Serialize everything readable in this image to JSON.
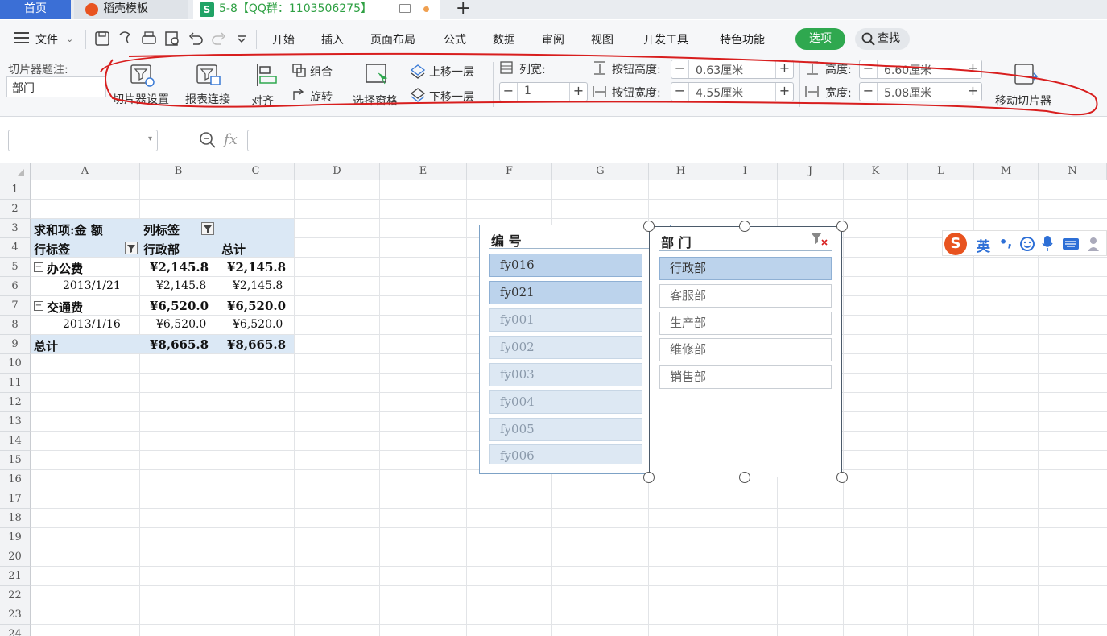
{
  "tabs": {
    "home": "首页",
    "daoke": "稻壳模板",
    "file": "5-8【QQ群：1103506275】",
    "file_icon": "S"
  },
  "menu": {
    "file": "文件",
    "items": [
      "开始",
      "插入",
      "页面布局",
      "公式",
      "数据",
      "审阅",
      "视图",
      "开发工具",
      "特色功能"
    ],
    "options": "选项",
    "search": "查找"
  },
  "ribbon": {
    "caption_label": "切片器题注:",
    "caption_value": "部门",
    "slicer_settings": "切片器设置",
    "report_connect": "报表连接",
    "align": "对齐",
    "group": "组合",
    "rotate": "旋转",
    "selection_pane": "选择窗格",
    "bring_forward": "上移一层",
    "send_backward": "下移一层",
    "columns_label": "列宽:",
    "columns_value": "1",
    "btn_height_label": "按钮高度:",
    "btn_height_value": "0.63厘米",
    "btn_width_label": "按钮宽度:",
    "btn_width_value": "4.55厘米",
    "height_label": "高度:",
    "height_value": "6.60厘米",
    "width_label": "宽度:",
    "width_value": "5.08厘米",
    "move_slicer": "移动切片器"
  },
  "formula": {
    "fx": "fx"
  },
  "columns": [
    "A",
    "B",
    "C",
    "D",
    "E",
    "F",
    "G",
    "H",
    "I",
    "J",
    "K",
    "L",
    "M",
    "N"
  ],
  "rows": [
    "1",
    "2",
    "3",
    "4",
    "5",
    "6",
    "7",
    "8",
    "9",
    "10",
    "11",
    "12",
    "13",
    "14",
    "15",
    "16",
    "17",
    "18",
    "19",
    "20",
    "21",
    "22",
    "23",
    "24"
  ],
  "pivot": {
    "sum_label": "求和项:金 额",
    "col_label": "列标签",
    "row_label": "行标签",
    "col1": "行政部",
    "total": "总计",
    "r5": {
      "a": "办公费",
      "b": "¥2,145.8",
      "c": "¥2,145.8"
    },
    "r6": {
      "a": "2013/1/21",
      "b": "¥2,145.8",
      "c": "¥2,145.8"
    },
    "r7": {
      "a": "交通费",
      "b": "¥6,520.0",
      "c": "¥6,520.0"
    },
    "r8": {
      "a": "2013/1/16",
      "b": "¥6,520.0",
      "c": "¥6,520.0"
    },
    "r9": {
      "a": "总计",
      "b": "¥8,665.8",
      "c": "¥8,665.8"
    }
  },
  "slicer1": {
    "title": "编 号",
    "items": [
      "fy016",
      "fy021",
      "fy001",
      "fy002",
      "fy003",
      "fy004",
      "fy005",
      "fy006"
    ]
  },
  "slicer2": {
    "title": "部 门",
    "items": [
      "行政部",
      "客服部",
      "生产部",
      "维修部",
      "销售部"
    ]
  },
  "ime": {
    "lang": "英",
    "punct": "•,"
  },
  "colors": {
    "accent": "#2fa84f",
    "home_tab": "#3b6fd6",
    "annotation": "#d81e1e"
  }
}
